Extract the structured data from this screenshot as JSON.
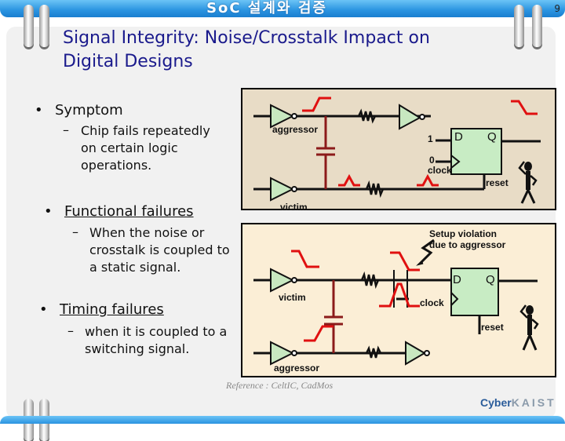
{
  "header": {
    "title": "SoC 설계와 검증",
    "page_number": "9"
  },
  "slide": {
    "title_line1": "Signal Integrity: Noise/Crosstalk Impact on",
    "title_line2": "Digital Designs",
    "bullets": [
      {
        "label": "Symptom",
        "sub": [
          "Chip fails repeatedly",
          "on certain logic",
          "operations."
        ]
      },
      {
        "label": "Functional failures",
        "sub": [
          "When the noise or",
          "crosstalk is coupled to",
          "a static signal."
        ]
      },
      {
        "label": "Timing failures",
        "sub": [
          "when it is coupled to a",
          "switching signal."
        ]
      }
    ]
  },
  "diagram_top": {
    "aggressor_label": "aggressor",
    "victim_label": "victim",
    "d_label": "D",
    "q_label": "Q",
    "d_input": "1",
    "clock_input": "0",
    "clock_label": "clock",
    "reset_label": "reset"
  },
  "diagram_bottom": {
    "annotation_line1": "Setup violation",
    "annotation_line2": "due to aggressor",
    "victim_label": "victim",
    "aggressor_label": "aggressor",
    "d_label": "D",
    "q_label": "Q",
    "clock_label": "clock",
    "reset_label": "reset"
  },
  "reference": "Reference : CeltIC, CadMos",
  "logo": {
    "part1": "Cyber",
    "part2": "KAIST"
  },
  "colors": {
    "signal": "#e01010",
    "wire": "#111111",
    "coupling": "#8b1a1a",
    "gate_fill": "#c8e8c0",
    "ff_fill": "#c8ecc4"
  }
}
